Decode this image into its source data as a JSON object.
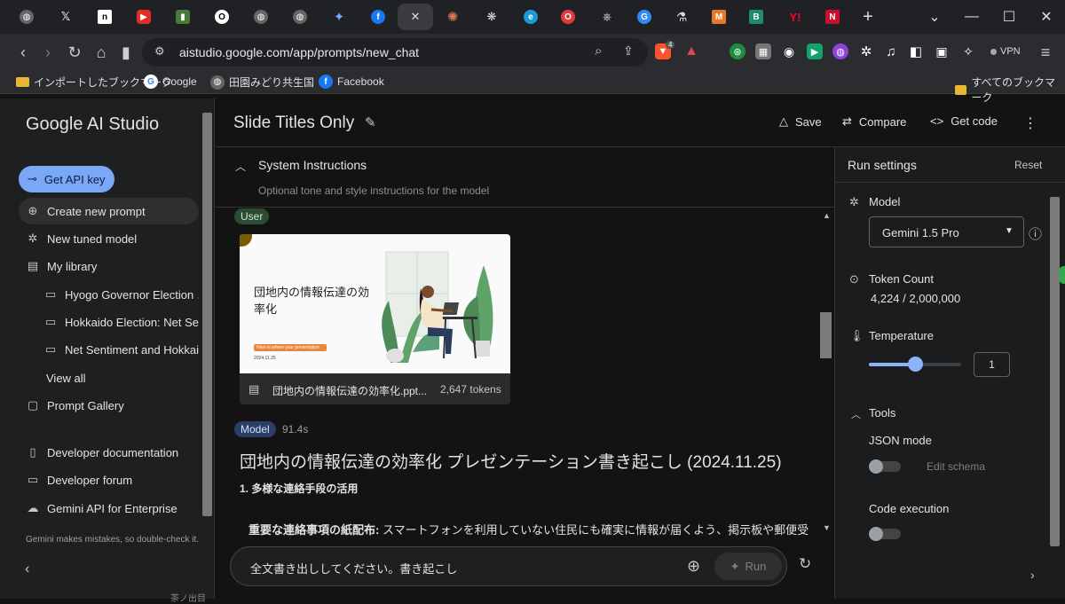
{
  "browser": {
    "url": "aistudio.google.com/app/prompts/new_chat",
    "brave_badge": "4",
    "vpn_label": "VPN",
    "bookmarks": [
      "インポートしたブックマーク",
      "Google",
      "田園みどり共生国",
      "Facebook"
    ],
    "all_bookmarks": "すべてのブックマーク"
  },
  "sidebar": {
    "brand": "Google AI Studio",
    "api_key": "Get API key",
    "items": [
      {
        "label": "Create new prompt"
      },
      {
        "label": "New tuned model"
      },
      {
        "label": "My library"
      },
      {
        "label": "Hyogo Governor Election ..."
      },
      {
        "label": "Hokkaido Election: Net Se..."
      },
      {
        "label": "Net Sentiment and Hokkai..."
      },
      {
        "label": "View all"
      },
      {
        "label": "Prompt Gallery"
      },
      {
        "label": "Developer documentation"
      },
      {
        "label": "Developer forum"
      },
      {
        "label": "Gemini API for Enterprise"
      }
    ],
    "disclaimer": "Gemini makes mistakes, so double-check it."
  },
  "header": {
    "title": "Slide Titles Only",
    "save": "Save",
    "compare": "Compare",
    "get_code": "Get code"
  },
  "chat": {
    "system_title": "System Instructions",
    "system_placeholder": "Optional tone and style instructions for the model",
    "user_chip": "User",
    "slide_title": "団地内の情報伝達の効率化",
    "slide_tag": "Here is where your presentation begins",
    "slide_date": "2024.11.25",
    "file_name": "団地内の情報伝達の効率化.ppt...",
    "file_tokens": "2,647 tokens",
    "model_chip": "Model",
    "model_time": "91.4s",
    "response_title": "団地内の情報伝達の効率化 プレゼンテーション書き起こし (2024.11.25)",
    "response_heading": "1. 多様な連絡手段の活用",
    "response_bullet_bold": "重要な連絡事項の紙配布:",
    "response_bullet_text": " スマートフォンを利用していない住民にも確実に情報が届くよう、掲示板や郵便受",
    "input_text": "全文書き出ししてください。書き起こし",
    "run": "Run",
    "stub_text": "茶ノ出目"
  },
  "run_settings": {
    "title": "Run settings",
    "reset": "Reset",
    "model_label": "Model",
    "model_value": "Gemini 1.5 Pro",
    "token_label": "Token Count",
    "token_value": "4,224 / 2,000,000",
    "temperature_label": "Temperature",
    "temperature_value": "1",
    "temperature_fraction": 0.5,
    "tools_label": "Tools",
    "json_mode": "JSON mode",
    "edit_schema": "Edit schema",
    "code_execution": "Code execution"
  }
}
